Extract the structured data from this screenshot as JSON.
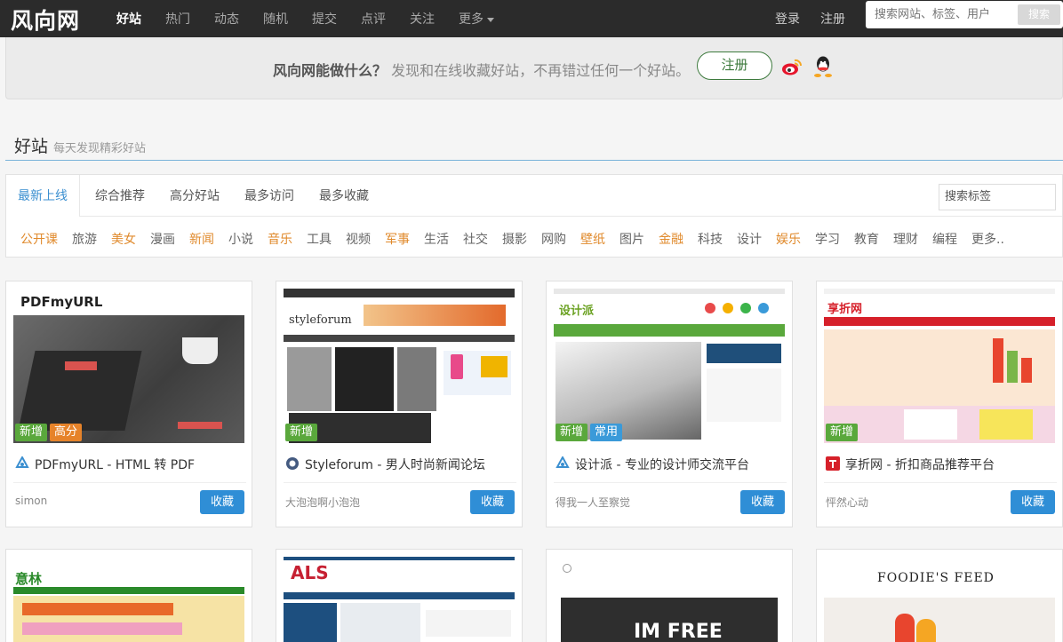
{
  "header": {
    "logo": "风向网",
    "nav": [
      "好站",
      "热门",
      "动态",
      "随机",
      "提交",
      "点评",
      "关注",
      "更多"
    ],
    "login": "登录",
    "register": "注册",
    "search_placeholder": "搜索网站、标签、用户",
    "search_button": "搜索"
  },
  "banner": {
    "question": "风向网能做什么？",
    "desc": "发现和在线收藏好站，不再错过任何一个好站。",
    "register_button": "注册"
  },
  "section": {
    "title": "好站",
    "subtitle": "每天发现精彩好站"
  },
  "tabs": [
    "最新上线",
    "综合推荐",
    "高分好站",
    "最多访问",
    "最多收藏"
  ],
  "tag_search": "搜索标签",
  "tags": [
    {
      "label": "公开课",
      "hot": true
    },
    {
      "label": "旅游",
      "hot": false
    },
    {
      "label": "美女",
      "hot": true
    },
    {
      "label": "漫画",
      "hot": false
    },
    {
      "label": "新闻",
      "hot": true
    },
    {
      "label": "小说",
      "hot": false
    },
    {
      "label": "音乐",
      "hot": true
    },
    {
      "label": "工具",
      "hot": false
    },
    {
      "label": "视频",
      "hot": false
    },
    {
      "label": "军事",
      "hot": true
    },
    {
      "label": "生活",
      "hot": false
    },
    {
      "label": "社交",
      "hot": false
    },
    {
      "label": "摄影",
      "hot": false
    },
    {
      "label": "网购",
      "hot": false
    },
    {
      "label": "壁纸",
      "hot": true
    },
    {
      "label": "图片",
      "hot": false
    },
    {
      "label": "金融",
      "hot": true
    },
    {
      "label": "科技",
      "hot": false
    },
    {
      "label": "设计",
      "hot": false
    },
    {
      "label": "娱乐",
      "hot": true
    },
    {
      "label": "学习",
      "hot": false
    },
    {
      "label": "教育",
      "hot": false
    },
    {
      "label": "理财",
      "hot": false
    },
    {
      "label": "编程",
      "hot": false
    },
    {
      "label": "更多..",
      "hot": false
    }
  ],
  "cards": [
    {
      "title": "PDFmyURL - HTML 转 PDF",
      "user": "simon",
      "badges": [
        "新增",
        "高分"
      ],
      "fav": "收藏",
      "thumb_text": "PDFmyURL"
    },
    {
      "title": "Styleforum - 男人时尚新闻论坛",
      "user": "大泡泡啊小泡泡",
      "badges": [
        "新增"
      ],
      "fav": "收藏",
      "thumb_text": "styleforum"
    },
    {
      "title": "设计派 - 专业的设计师交流平台",
      "user": "得我一人至察觉",
      "badges": [
        "新增",
        "常用"
      ],
      "fav": "收藏",
      "thumb_text": "设计派"
    },
    {
      "title": "享折网 - 折扣商品推荐平台",
      "user": "怦然心动",
      "badges": [
        "新增"
      ],
      "fav": "收藏",
      "thumb_text": "享折网"
    }
  ],
  "row2_thumbs": [
    "意林",
    "ALS",
    "IM FREE",
    "FOODIE'S FEED"
  ]
}
